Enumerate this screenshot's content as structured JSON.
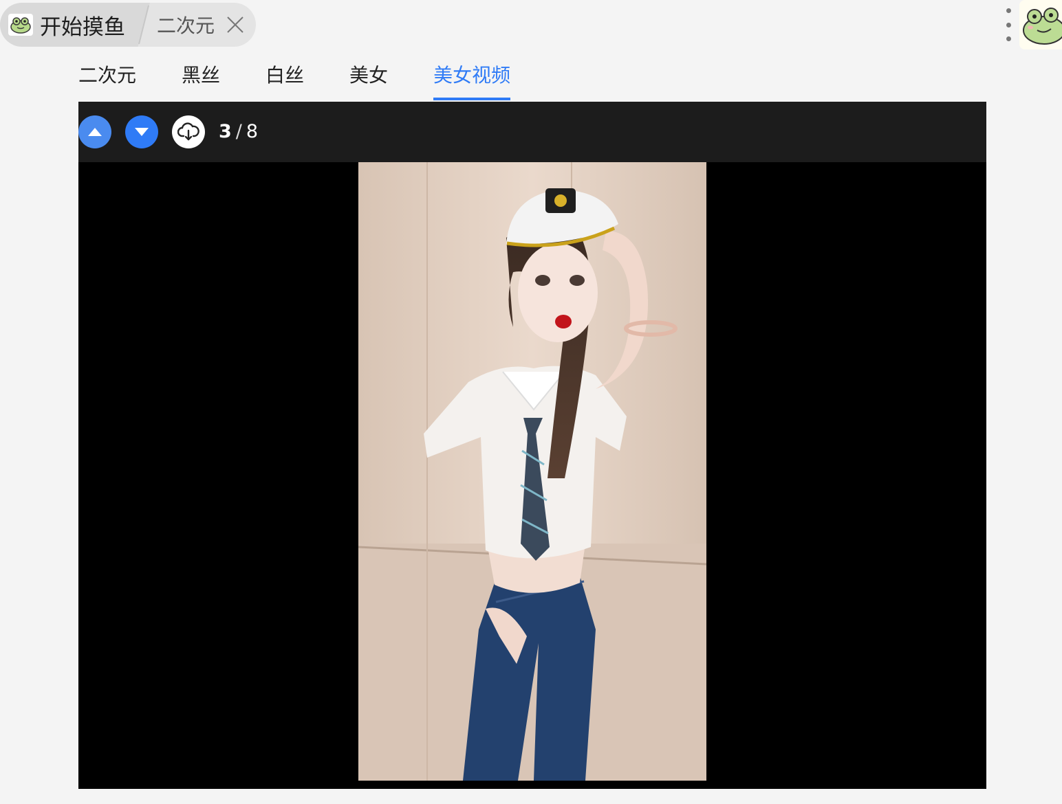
{
  "breadcrumb": {
    "home_label": "开始摸鱼",
    "current_label": "二次元"
  },
  "tabs": [
    {
      "label": "二次元",
      "active": false
    },
    {
      "label": "黑丝",
      "active": false
    },
    {
      "label": "白丝",
      "active": false
    },
    {
      "label": "美女",
      "active": false
    },
    {
      "label": "美女视频",
      "active": true
    }
  ],
  "player": {
    "current_index": "3",
    "total": "8"
  },
  "colors": {
    "accent": "#2f7bf6",
    "page_bg": "#f4f4f4",
    "toolbar_bg": "#1c1c1c"
  },
  "icons": {
    "home": "frog-icon",
    "close": "close-icon",
    "prev": "arrow-up-icon",
    "next": "arrow-down-icon",
    "download": "cloud-download-icon",
    "more": "more-vertical-icon"
  }
}
